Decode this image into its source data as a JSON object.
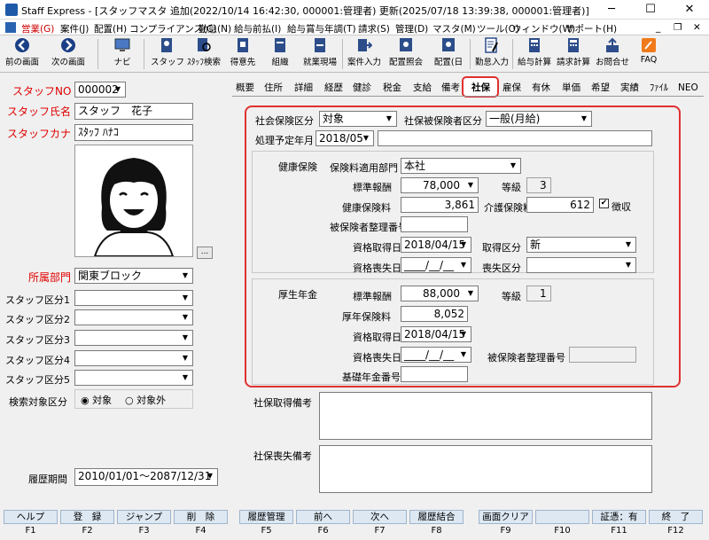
{
  "window": {
    "title": "Staff Express - [スタッフマスタ 追加(2022/10/14 16:42:30, 000001:管理者) 更新(2025/07/18 13:39:38, 000001:管理者)]"
  },
  "menu": [
    "営業(G)",
    "案件(J)",
    "配置(H)",
    "コンプライアンス(C)",
    "勤怠(N)",
    "給与前払(I)",
    "給与賞与年調(T)",
    "請求(S)",
    "管理(D)",
    "マスタ(M)",
    "ツール(O)",
    "ウィンドウ(W)",
    "サポート(H)"
  ],
  "toolbar": {
    "prev": "前の画面",
    "next": "次の画面",
    "navi": "ナビ",
    "staff": "スタッフ",
    "staff_search": "ｽﾀｯﾌ検索",
    "client": "得意先",
    "org": "組織",
    "site": "就業現場",
    "job_entry": "案件入力",
    "assign_view": "配置照会",
    "assign_day": "配置(日",
    "attendance": "勤怠入力",
    "payroll": "給与計算",
    "billing": "請求計算",
    "inquiry": "お問合せ",
    "faq": "FAQ"
  },
  "left": {
    "staff_no_label": "スタッフNO",
    "staff_no": "000002",
    "staff_name_label": "スタッフ氏名",
    "staff_name": "スタッフ　花子",
    "staff_kana_label": "スタッフカナ",
    "staff_kana": "ｽﾀｯﾌ ﾊﾅｺ",
    "more": "...",
    "dept_label": "所属部門",
    "dept": "関東ブロック",
    "cat1": "スタッフ区分1",
    "cat2": "スタッフ区分2",
    "cat3": "スタッフ区分3",
    "cat4": "スタッフ区分4",
    "cat5": "スタッフ区分5",
    "search_label": "検索対象区分",
    "radio_on": "対象",
    "radio_off": "対象外",
    "period_label": "履歴期間",
    "period": "2010/01/01～2087/12/31"
  },
  "tabs": [
    "概要",
    "住所",
    "詳細",
    "経歴",
    "健診",
    "税金",
    "支給",
    "備考",
    "社保",
    "雇保",
    "有休",
    "単価",
    "希望",
    "実績",
    "ﾌｧｲﾙ",
    "NEO"
  ],
  "form": {
    "ins_cat_label": "社会保険区分",
    "ins_cat": "対象",
    "insured_cat_label": "社保被保険者区分",
    "insured_cat": "一般(月給)",
    "proc_label": "処理予定年月",
    "proc": "2018/05",
    "health_label": "健康保険",
    "dept_label": "保険料適用部門",
    "dept": "本社",
    "std_label": "標準報酬",
    "std": "78,000",
    "grade_label": "等級",
    "grade": "3",
    "fee_label": "健康保険料",
    "fee": "3,861",
    "care_label": "介護保険料",
    "care": "612",
    "collect_label": "徴収",
    "num_label": "被保険者整理番号",
    "acq_date_label": "資格取得日",
    "acq_date": "2018/04/15",
    "acq_type_label": "取得区分",
    "acq_type": "新",
    "loss_date_label": "資格喪失日",
    "loss_date": "____/__/__",
    "loss_type_label": "喪失区分",
    "pension_label": "厚生年金",
    "p_std_label": "標準報酬",
    "p_std": "88,000",
    "p_grade_label": "等級",
    "p_grade": "1",
    "p_fee_label": "厚年保険料",
    "p_fee": "8,052",
    "p_acq_label": "資格取得日",
    "p_acq": "2018/04/15",
    "p_loss_label": "資格喪失日",
    "p_loss": "____/__/__",
    "p_num_label": "被保険者整理番号",
    "basic_label": "基礎年金番号",
    "acq_note_label": "社保取得備考",
    "loss_note_label": "社保喪失備考"
  },
  "fkeys": [
    {
      "label": "ヘルプ",
      "key": "F1"
    },
    {
      "label": "登　録",
      "key": "F2"
    },
    {
      "label": "ジャンプ",
      "key": "F3"
    },
    {
      "label": "削　除",
      "key": "F4"
    },
    {
      "label": "履歴管理",
      "key": "F5"
    },
    {
      "label": "前へ",
      "key": "F6"
    },
    {
      "label": "次へ",
      "key": "F7"
    },
    {
      "label": "履歴結合",
      "key": "F8"
    },
    {
      "label": "画面クリア",
      "key": "F9"
    },
    {
      "label": "",
      "key": "F10"
    },
    {
      "label": "証憑：有",
      "key": "F11"
    },
    {
      "label": "終　了",
      "key": "F12"
    }
  ],
  "colors": {
    "accent": "#e03030",
    "label_red": "#e00000",
    "fkey_bg": "#dde8f3"
  }
}
